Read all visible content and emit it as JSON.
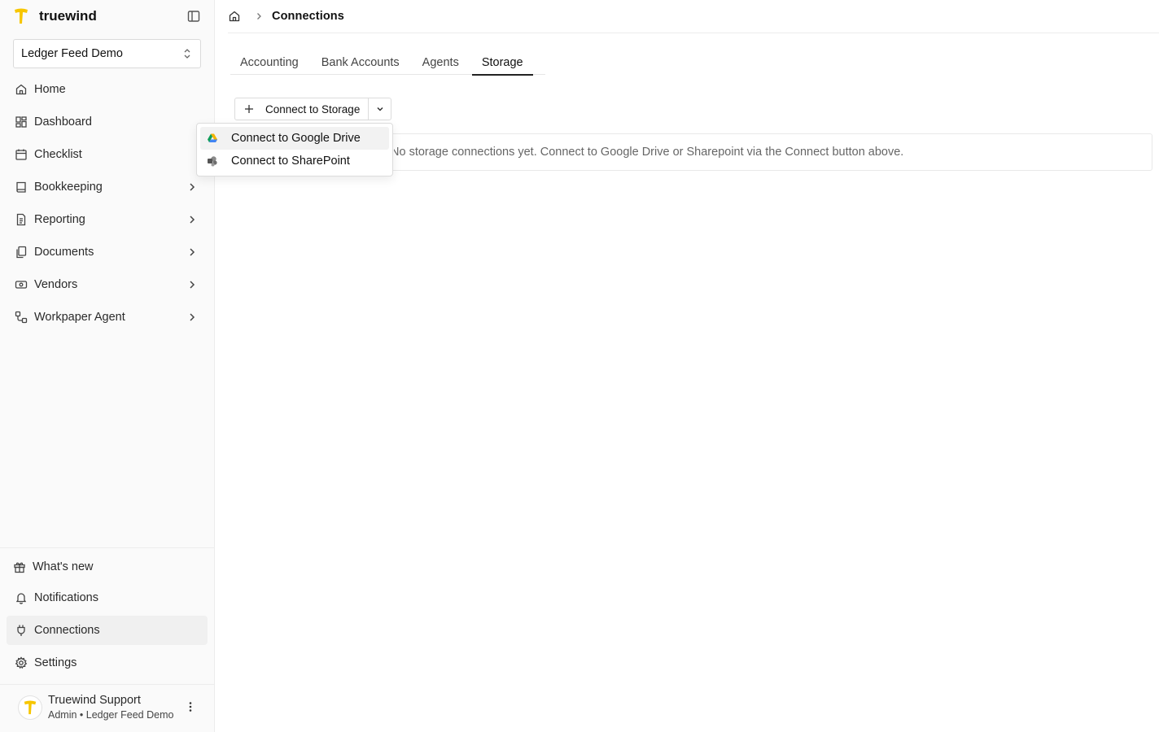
{
  "app": {
    "name": "truewind",
    "brand_color": "#f7c600"
  },
  "org_selector": {
    "value": "Ledger Feed Demo"
  },
  "nav": {
    "items": [
      {
        "label": "Home",
        "icon": "home-icon",
        "expandable": false
      },
      {
        "label": "Dashboard",
        "icon": "dashboard-icon",
        "expandable": false
      },
      {
        "label": "Checklist",
        "icon": "calendar-icon",
        "expandable": false
      },
      {
        "label": "Bookkeeping",
        "icon": "book-icon",
        "expandable": true
      },
      {
        "label": "Reporting",
        "icon": "report-icon",
        "expandable": true
      },
      {
        "label": "Documents",
        "icon": "documents-icon",
        "expandable": true
      },
      {
        "label": "Vendors",
        "icon": "vendor-icon",
        "expandable": true
      },
      {
        "label": "Workpaper Agent",
        "icon": "workflow-icon",
        "expandable": true
      }
    ],
    "bottom": [
      {
        "label": "What's new",
        "icon": "gift-icon"
      },
      {
        "label": "Notifications",
        "icon": "bell-icon"
      },
      {
        "label": "Connections",
        "icon": "plug-icon",
        "active": true
      },
      {
        "label": "Settings",
        "icon": "gear-icon"
      }
    ]
  },
  "user": {
    "name": "Truewind Support",
    "role": "Admin • Ledger Feed Demo"
  },
  "breadcrumb": {
    "current": "Connections"
  },
  "tabs": [
    {
      "label": "Accounting",
      "active": false
    },
    {
      "label": "Bank Accounts",
      "active": false
    },
    {
      "label": "Agents",
      "active": false
    },
    {
      "label": "Storage",
      "active": true
    }
  ],
  "storage": {
    "connect_button": "Connect to Storage",
    "empty_message": "No storage connections yet. Connect to Google Drive or Sharepoint via the Connect button above."
  },
  "dropdown": {
    "items": [
      {
        "label": "Connect to Google Drive",
        "icon": "google-drive-icon"
      },
      {
        "label": "Connect to SharePoint",
        "icon": "sharepoint-icon"
      }
    ]
  }
}
